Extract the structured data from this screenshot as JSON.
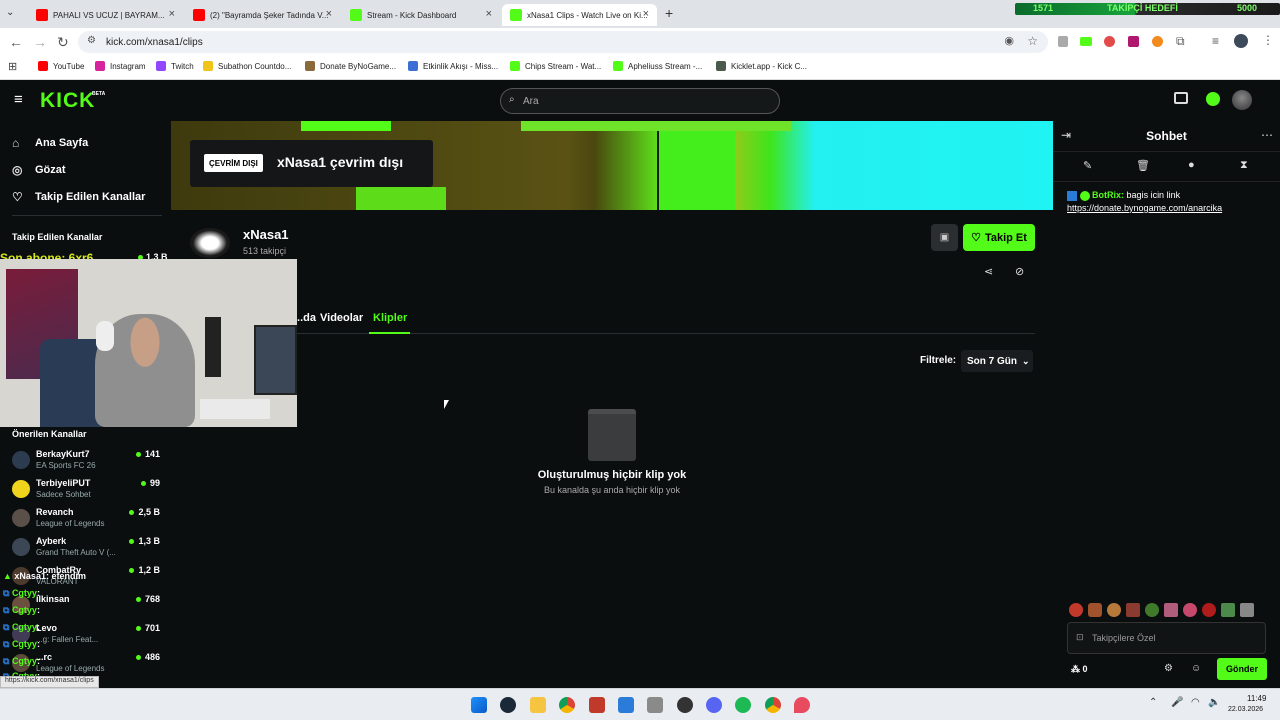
{
  "browser": {
    "tabs": [
      {
        "title": "PAHALI VS UCUZ | BAYRAM...",
        "color": "#ff0000"
      },
      {
        "title": "(2) \"Bayramda Şeker Tadında V...",
        "color": "#ff0000"
      },
      {
        "title": "Stream - Kick Dashboard",
        "color": "#53fc18"
      },
      {
        "title": "xNasa1 Clips - Watch Live on Ki...",
        "color": "#53fc18"
      }
    ],
    "url": "kick.com/xnasa1/clips",
    "bookmarks": [
      "YouTube",
      "Instagram",
      "Twitch",
      "Subathon Countdo...",
      "Donate ByNoGame...",
      "Etkinlik Akışı - Miss...",
      "Chips Stream - Wat...",
      "Apheliuss Stream -...",
      "Kicklet.app - Kick C..."
    ],
    "overlay": {
      "left_count": "1571",
      "goal_label": "TAKİPÇİ HEDEFİ",
      "goal_value": "5000"
    }
  },
  "kick": {
    "logo": "KICK",
    "logo_badge": "BETA",
    "search_placeholder": "Ara"
  },
  "sidebar": {
    "nav": [
      {
        "label": "Ana Sayfa",
        "icon": "home-icon"
      },
      {
        "label": "Gözat",
        "icon": "compass-icon"
      },
      {
        "label": "Takip Edilen Kanallar",
        "icon": "heart-icon"
      }
    ],
    "followed_header": "Takip Edilen Kanallar",
    "followed_viewers": "1,3 B",
    "recommended_header": "Önerilen Kanallar",
    "recommended": [
      {
        "name": "BerkayKurt7",
        "game": "EA Sports FC 26",
        "viewers": "141",
        "color": "#2c3b4f"
      },
      {
        "name": "TerbiyeliPUT",
        "game": "Sadece Sohbet",
        "viewers": "99",
        "color": "#f0d31c"
      },
      {
        "name": "Revanch",
        "game": "League of Legends",
        "viewers": "2,5 B",
        "color": "#5a4f49"
      },
      {
        "name": "Ayberk",
        "game": "Grand Theft Auto V (...",
        "viewers": "1,3 B",
        "color": "#3c4755"
      },
      {
        "name": "CombatRy",
        "game": "VALORANT",
        "viewers": "1,2 B",
        "color": "#4d3b2e"
      },
      {
        "name": "ilkinsan",
        "game": "",
        "viewers": "768",
        "color": "#6b5040"
      },
      {
        "name": "Levo",
        "game": "...g: Fallen Feat...",
        "viewers": "701",
        "color": "#413b55"
      },
      {
        "name": "...rc",
        "game": "League of Legends",
        "viewers": "486",
        "color": "#5b4b3b"
      }
    ]
  },
  "channel": {
    "offline_badge": "ÇEVRİM DIŞI",
    "offline_text": "xNasa1 çevrim dışı",
    "name": "xNasa1",
    "followers": "513 takipçi",
    "follow_label": "Takip Et",
    "tabs": [
      "...da",
      "Videolar",
      "Klipler"
    ],
    "filter_label": "Filtrele:",
    "filter_value": "Son 7 Gün",
    "empty_title": "Oluşturulmuş hiçbir klip yok",
    "empty_subtitle": "Bu kanalda şu anda hiçbir klip yok"
  },
  "chat": {
    "title": "Sohbet",
    "message_user": "BotRix:",
    "message_text": "bagis icin link",
    "message_link": "https://donate.bynogame.com/anarcika",
    "input_placeholder": "Takipçilere Özel",
    "points": "0",
    "send_label": "Gönder"
  },
  "overlay": {
    "sub_label": "Son abone: 6xr6",
    "chat_lines": [
      {
        "user": "xNasa1",
        "text": ": efendim"
      },
      {
        "user": "Cgtyy",
        "text": ":"
      },
      {
        "user": "Cgtyy",
        "text": ":"
      },
      {
        "user": "Cgtyy",
        "text": ":"
      },
      {
        "user": "Cgtyy",
        "text": ":"
      },
      {
        "user": "Cgtyy",
        "text": ":"
      },
      {
        "user": "Cgtyy",
        "text": ":"
      }
    ],
    "bottom_user_1": "salih362",
    "bottom_user_2": "salih362",
    "status_url": "https://kick.com/xnasa1/clips"
  },
  "taskbar": {
    "time": "11:49",
    "date": "22.03.2026"
  }
}
